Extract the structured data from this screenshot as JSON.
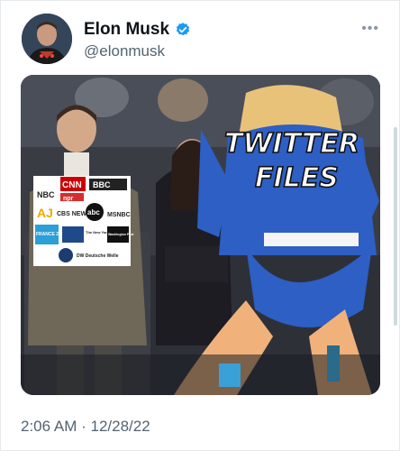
{
  "tweet": {
    "author": {
      "display_name": "Elon Musk",
      "handle": "@elonmusk",
      "verified": true,
      "verified_color": "#1d9bf0"
    },
    "more_icon": "more-horizontal-icon",
    "media": {
      "overlay_text_line1": "TWITTER",
      "overlay_text_line2": "FILES",
      "logos": [
        "NBC",
        "CNN",
        "BBC",
        "npr",
        "AJ",
        "CBS NEWS",
        "abc",
        "MSNBC",
        "FRANCE 24",
        "The New York Times",
        "Washington Post",
        "DW Deutsche Welle"
      ]
    },
    "time": "2:06 AM",
    "separator": "·",
    "date": "12/28/22"
  }
}
